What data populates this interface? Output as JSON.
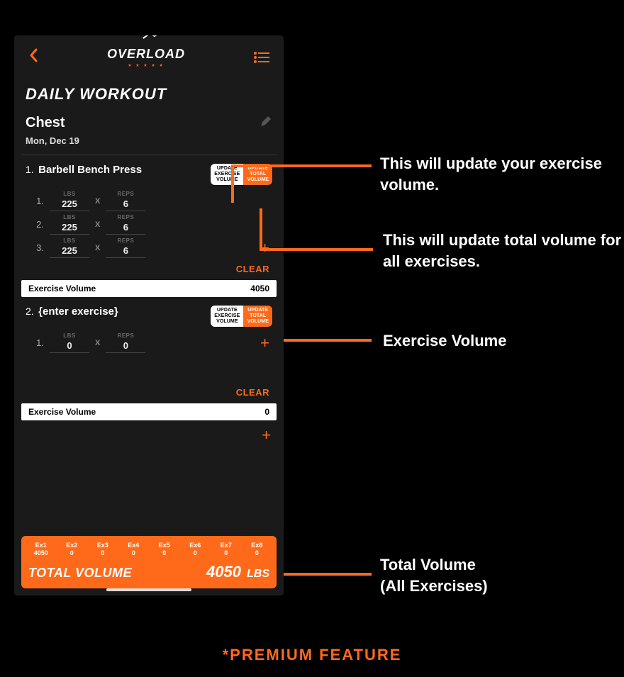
{
  "colors": {
    "accent": "#ff6a1a",
    "bg": "#1a1a1a"
  },
  "logo": {
    "text": "OVERLOAD"
  },
  "header": {
    "page_title": "DAILY WORKOUT",
    "body_part": "Chest",
    "date": "Mon, Dec 19"
  },
  "toggle": {
    "exercise": "UPDATE\nEXERCISE\nVOLUME",
    "total": "UPDATE\nTOTAL\nVOLUME"
  },
  "labels": {
    "lbs": "LBS",
    "reps": "REPS",
    "x": "X",
    "clear": "CLEAR",
    "exercise_volume": "Exercise Volume",
    "plus": "+"
  },
  "exercises": [
    {
      "number": "1.",
      "name": "Barbell Bench Press",
      "sets": [
        {
          "n": "1.",
          "lbs": "225",
          "reps": "6"
        },
        {
          "n": "2.",
          "lbs": "225",
          "reps": "6"
        },
        {
          "n": "3.",
          "lbs": "225",
          "reps": "6"
        }
      ],
      "volume": "4050"
    },
    {
      "number": "2.",
      "name": "{enter exercise}",
      "sets": [
        {
          "n": "1.",
          "lbs": "0",
          "reps": "0"
        }
      ],
      "volume": "0"
    }
  ],
  "total_panel": {
    "columns": [
      {
        "label": "Ex1",
        "val": "4050"
      },
      {
        "label": "Ex2",
        "val": "0"
      },
      {
        "label": "Ex3",
        "val": "0"
      },
      {
        "label": "Ex4",
        "val": "0"
      },
      {
        "label": "Ex5",
        "val": "0"
      },
      {
        "label": "Ex6",
        "val": "0"
      },
      {
        "label": "Ex7",
        "val": "0"
      },
      {
        "label": "Ex8",
        "val": "0"
      }
    ],
    "label": "TOTAL VOLUME",
    "value": "4050",
    "unit": "LBS"
  },
  "annotations": {
    "a1": "This will update your exercise volume.",
    "a2": "This will update total volume for all exercises.",
    "a3": "Exercise Volume",
    "a4_line1": "Total Volume",
    "a4_line2": "(All Exercises)"
  },
  "footer": {
    "premium": "*PREMIUM FEATURE"
  }
}
